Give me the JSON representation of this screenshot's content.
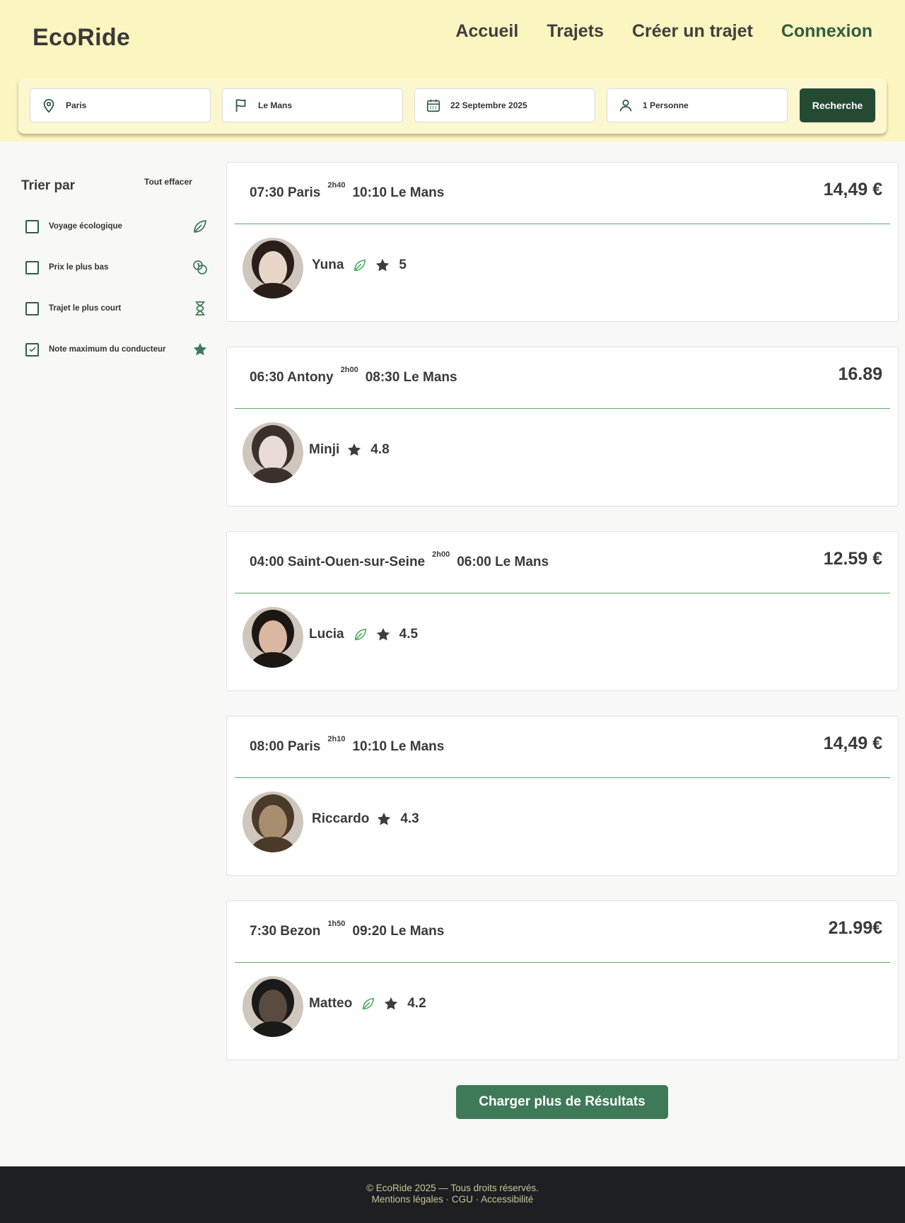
{
  "header": {
    "logo": "EcoRide",
    "nav": [
      "Accueil",
      "Trajets",
      "Créer un trajet",
      "Connexion"
    ]
  },
  "search": {
    "from": "Paris",
    "to": "Le Mans",
    "date": "22 Septembre  2025",
    "passengers": "1 Personne",
    "button": "Recherche"
  },
  "sidebar": {
    "title": "Trier par",
    "clear": "Tout effacer",
    "filters": [
      {
        "label": "Voyage écologique",
        "checked": false,
        "icon": "leaf-icon"
      },
      {
        "label": "Prix le plus bas",
        "checked": false,
        "icon": "coins-icon"
      },
      {
        "label": "Trajet le plus court",
        "checked": false,
        "icon": "hourglass-icon"
      },
      {
        "label": "Note maximum du conducteur",
        "checked": true,
        "icon": "star-icon"
      }
    ]
  },
  "trips": [
    {
      "depart": "07:30 Paris",
      "duration": "2h40",
      "arrive": "10:10 Le Mans",
      "price": "14,49 €",
      "driver": "Yuna",
      "eco": true,
      "rating": "5"
    },
    {
      "depart": "06:30 Antony",
      "duration": "2h00",
      "arrive": "08:30 Le Mans",
      "price": "16.89",
      "driver": "Minji",
      "eco": false,
      "rating": "4.8"
    },
    {
      "depart": "04:00 Saint-Ouen-sur-Seine",
      "duration": "2h00",
      "arrive": "06:00 Le Mans",
      "price": "12.59 €",
      "driver": "Lucia",
      "eco": true,
      "rating": "4.5"
    },
    {
      "depart": "08:00 Paris",
      "duration": "2h10",
      "arrive": "10:10 Le Mans",
      "price": "14,49 €",
      "driver": "Riccardo",
      "eco": false,
      "rating": "4.3"
    },
    {
      "depart": "7:30 Bezon",
      "duration": "1h50",
      "arrive": "09:20 Le Mans",
      "price": "21.99€",
      "driver": "Matteo",
      "eco": true,
      "rating": "4.2"
    }
  ],
  "load_more": "Charger plus de Résultats",
  "footer": {
    "line1": "© EcoRide 2025 — Tous droits réservés.",
    "line2": "Mentions légales · CGU · Accessibilité"
  },
  "colors": {
    "header_bg": "#fbf5bf",
    "primary_dark": "#254a34",
    "accent_green": "#5cad6b",
    "button_green": "#3f7a58",
    "footer_bg": "#1e1f22"
  }
}
